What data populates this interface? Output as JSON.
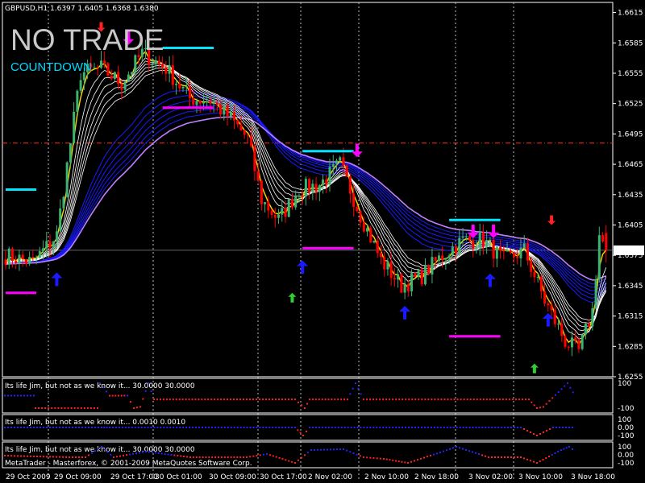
{
  "chart_title": "GBPUSD,H1  1.6397 1.6405 1.6368 1.6380",
  "status": {
    "signal": "NO TRADE",
    "countdown": "COUNTDOWN"
  },
  "copyright": "MetaTrader - Masterforex, © 2001-2009 MetaQuotes Software Corp.",
  "current_price_label": "1.6380",
  "colors": {
    "background": "#000000",
    "bull": "#3cb371",
    "bear": "#ff0000",
    "grid": "#c0c0c0",
    "ribbon_white": "#ffffff",
    "ribbon_blue": "#1a1aff",
    "ribbon_violet": "#c080ff",
    "signal_line": "#ffd800",
    "resistance": "#00e5ff",
    "support": "#ff00ff",
    "buy_arrow": "#1a1aff",
    "sell_arrow": "#ff00ff"
  },
  "indicators": [
    {
      "label": "Its life Jim, but not as we know it...  30.0000 30.0000",
      "levels": [
        "100",
        "-100"
      ]
    },
    {
      "label": "Its life Jim, but not as we know it...  0.0010 0.0010",
      "levels": [
        "100",
        "0.00",
        "-100"
      ]
    },
    {
      "label": "Its life Jim, but not as we know it...  30.0000 30.0000",
      "levels": [
        "100",
        "0.00",
        "-100"
      ]
    }
  ],
  "chart_data": {
    "type": "candlestick",
    "symbol": "GBPUSD",
    "timeframe": "H1",
    "ohlc_last": {
      "open": 1.6397,
      "high": 1.6405,
      "low": 1.6368,
      "close": 1.638
    },
    "ylim": [
      1.6255,
      1.6625
    ],
    "y_ticks": [
      1.6615,
      1.6585,
      1.6555,
      1.6525,
      1.6495,
      1.6465,
      1.6435,
      1.6405,
      1.6375,
      1.6345,
      1.6315,
      1.6285,
      1.6255
    ],
    "x_ticks": [
      "29 Oct 2009",
      "29 Oct 09:00",
      "29 Oct 17:00",
      "30 Oct 01:00",
      "30 Oct 09:00",
      "30 Oct 17:00",
      "2 Nov 02:00",
      "2 Nov 10:00",
      "2 Nov 18:00",
      "3 Nov 02:00",
      "3 Nov 10:00",
      "3 Nov 18:00"
    ],
    "hline_level": 1.6486,
    "anchors": [
      [
        0,
        1.6375
      ],
      [
        8,
        1.6368
      ],
      [
        15,
        1.6395
      ],
      [
        22,
        1.6555
      ],
      [
        28,
        1.656
      ],
      [
        34,
        1.6545
      ],
      [
        40,
        1.6575
      ],
      [
        47,
        1.656
      ],
      [
        54,
        1.653
      ],
      [
        60,
        1.6528
      ],
      [
        66,
        1.651
      ],
      [
        71,
        1.649
      ],
      [
        75,
        1.643
      ],
      [
        80,
        1.641
      ],
      [
        86,
        1.644
      ],
      [
        92,
        1.6445
      ],
      [
        98,
        1.6465
      ],
      [
        104,
        1.6415
      ],
      [
        110,
        1.637
      ],
      [
        116,
        1.6345
      ],
      [
        122,
        1.6355
      ],
      [
        128,
        1.6375
      ],
      [
        134,
        1.639
      ],
      [
        140,
        1.639
      ],
      [
        146,
        1.637
      ],
      [
        152,
        1.638
      ],
      [
        158,
        1.633
      ],
      [
        164,
        1.629
      ],
      [
        168,
        1.628
      ],
      [
        172,
        1.632
      ],
      [
        174,
        1.6395
      ],
      [
        176,
        1.638
      ]
    ],
    "cyan_levels": [
      {
        "price": 1.644,
        "from": 0,
        "to": 9
      },
      {
        "price": 1.658,
        "from": 46,
        "to": 61
      },
      {
        "price": 1.6478,
        "from": 87,
        "to": 102
      },
      {
        "price": 1.641,
        "from": 130,
        "to": 145
      }
    ],
    "magenta_levels": [
      {
        "price": 1.6338,
        "from": 0,
        "to": 9
      },
      {
        "price": 1.6521,
        "from": 46,
        "to": 61
      },
      {
        "price": 1.6382,
        "from": 87,
        "to": 102
      },
      {
        "price": 1.6295,
        "from": 130,
        "to": 145
      }
    ],
    "buy_arrows": [
      {
        "bar": 15,
        "price": 1.6358
      },
      {
        "bar": 87,
        "price": 1.637
      },
      {
        "bar": 117,
        "price": 1.6325
      },
      {
        "bar": 142,
        "price": 1.6357
      },
      {
        "bar": 159,
        "price": 1.6318
      }
    ],
    "sell_arrows": [
      {
        "bar": 36,
        "price": 1.6583
      },
      {
        "bar": 103,
        "price": 1.6472
      },
      {
        "bar": 137,
        "price": 1.6392
      },
      {
        "bar": 143,
        "price": 1.6392
      }
    ],
    "green_up_arrows": [
      {
        "bar": 84,
        "price": 1.6338
      },
      {
        "bar": 155,
        "price": 1.6268
      }
    ],
    "red_down_arrows": [
      {
        "bar": 28,
        "price": 1.6596
      },
      {
        "bar": 160,
        "price": 1.6405
      }
    ]
  }
}
